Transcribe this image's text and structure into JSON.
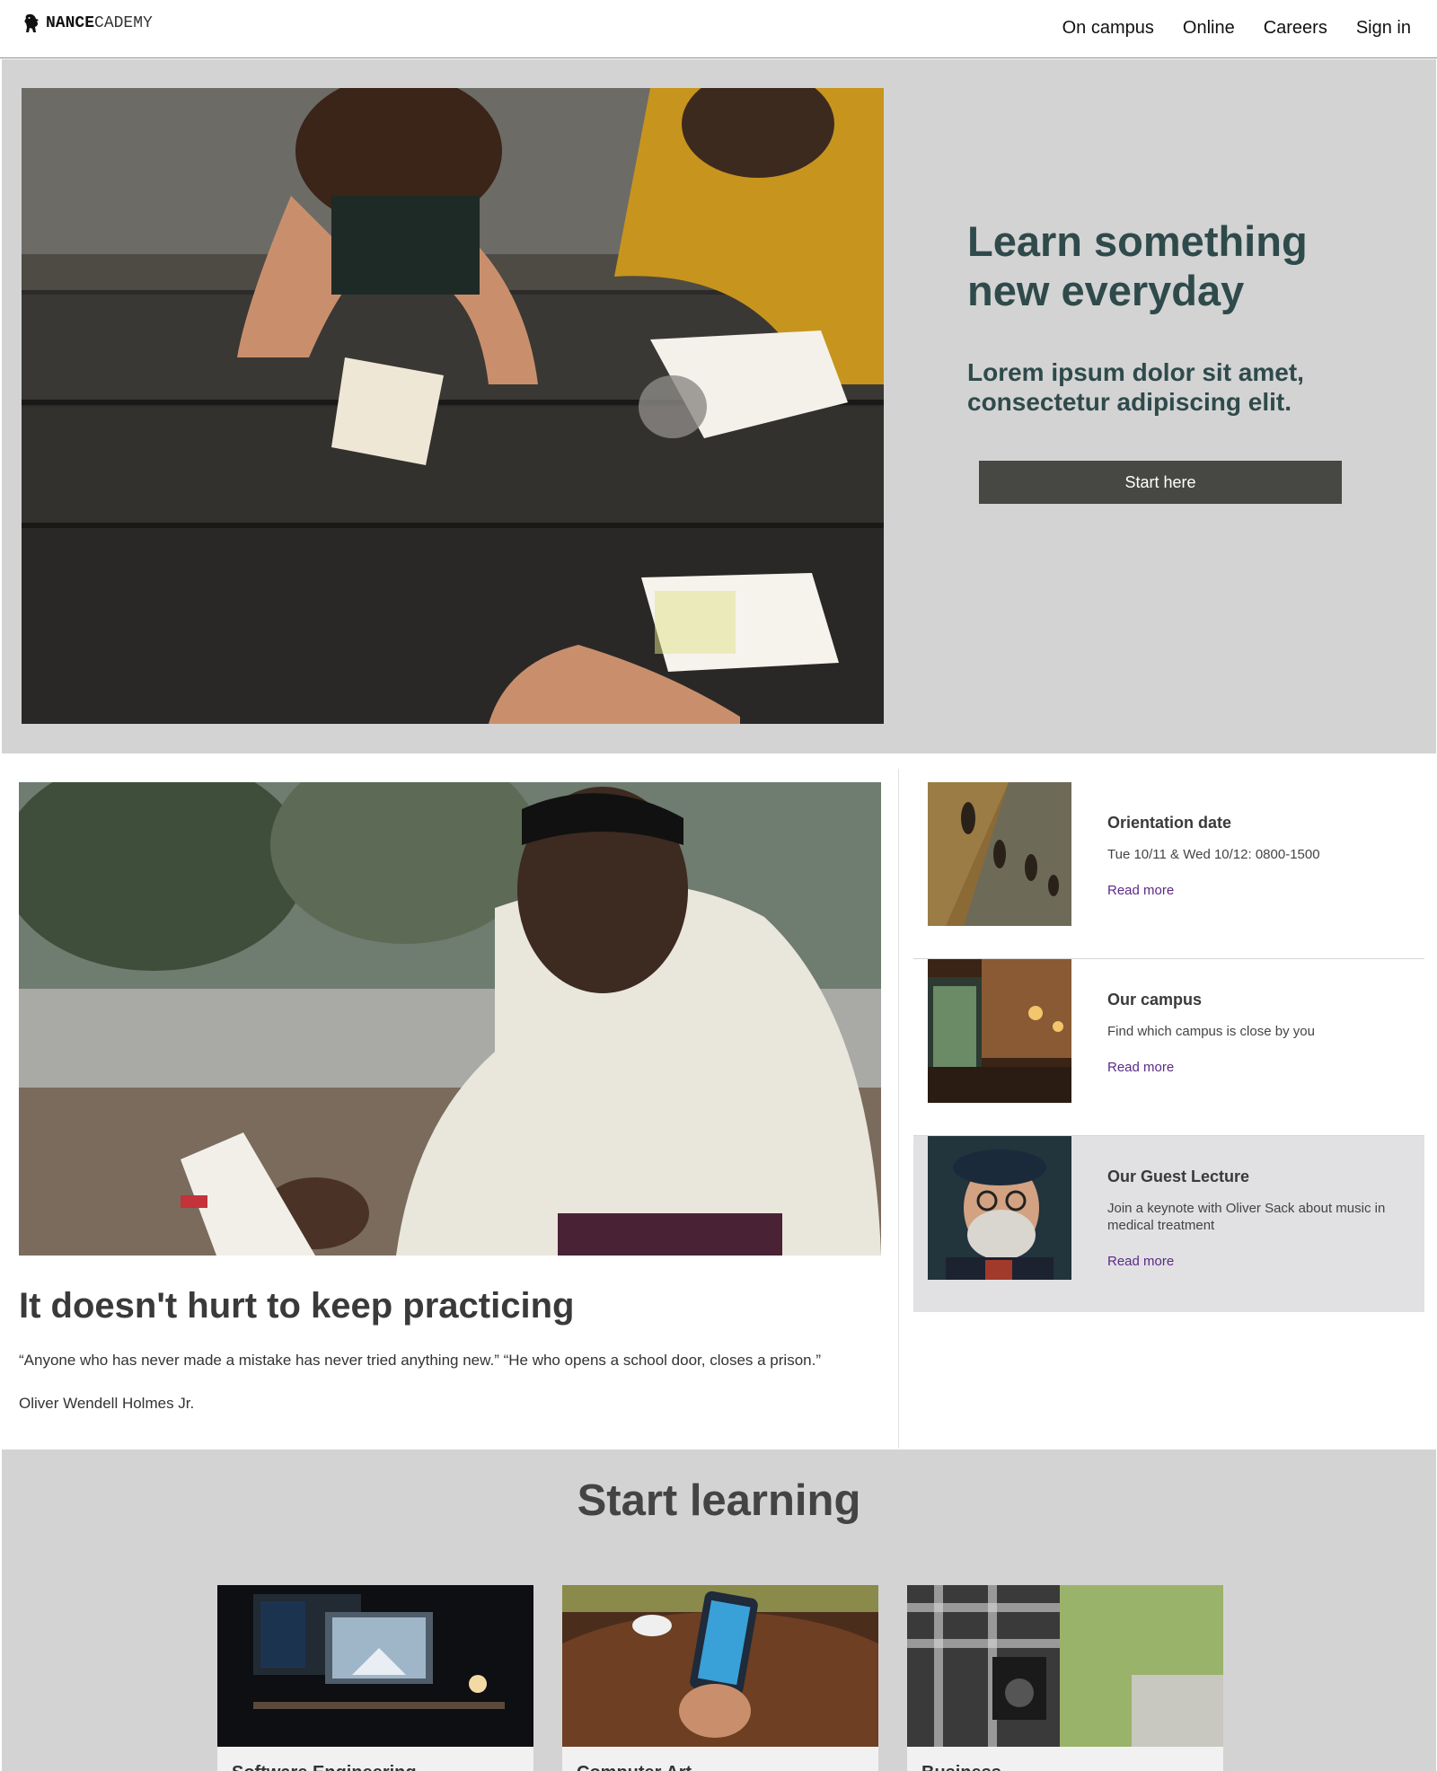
{
  "header": {
    "brand_bold": "NANCE",
    "brand_light": "CADEMY",
    "nav": [
      "On campus",
      "Online",
      "Careers",
      "Sign in"
    ]
  },
  "hero": {
    "title": "Learn something new everyday",
    "subtitle": "Lorem ipsum dolor sit amet, consectetur adipiscing elit.",
    "button": "Start here"
  },
  "feature": {
    "title": "It doesn't hurt to keep practicing",
    "quote": "“Anyone who has never made a mistake has never tried anything new.” “He who opens a school door, closes a prison.”",
    "author": "Oliver Wendell Holmes Jr."
  },
  "side": [
    {
      "title": "Orientation date",
      "desc": "Tue 10/11 & Wed 10/12: 0800-1500",
      "link": "Read more"
    },
    {
      "title": "Our campus",
      "desc": "Find which campus is close by you",
      "link": "Read more"
    },
    {
      "title": "Our Guest Lecture",
      "desc": "Join a keynote with Oliver Sack about music in medical treatment",
      "link": "Read more"
    }
  ],
  "learn": {
    "title": "Start learning",
    "courses": [
      "Software Engineering",
      "Computer Art",
      "Business"
    ]
  },
  "colors": {
    "hero_bg": "#d3d3d3",
    "hero_text": "#2f4a4b",
    "button_bg": "#474744",
    "link": "#5b2a86",
    "highlight_card_bg": "#e1e1e3"
  },
  "icons": [
    "lion-logo-icon"
  ]
}
